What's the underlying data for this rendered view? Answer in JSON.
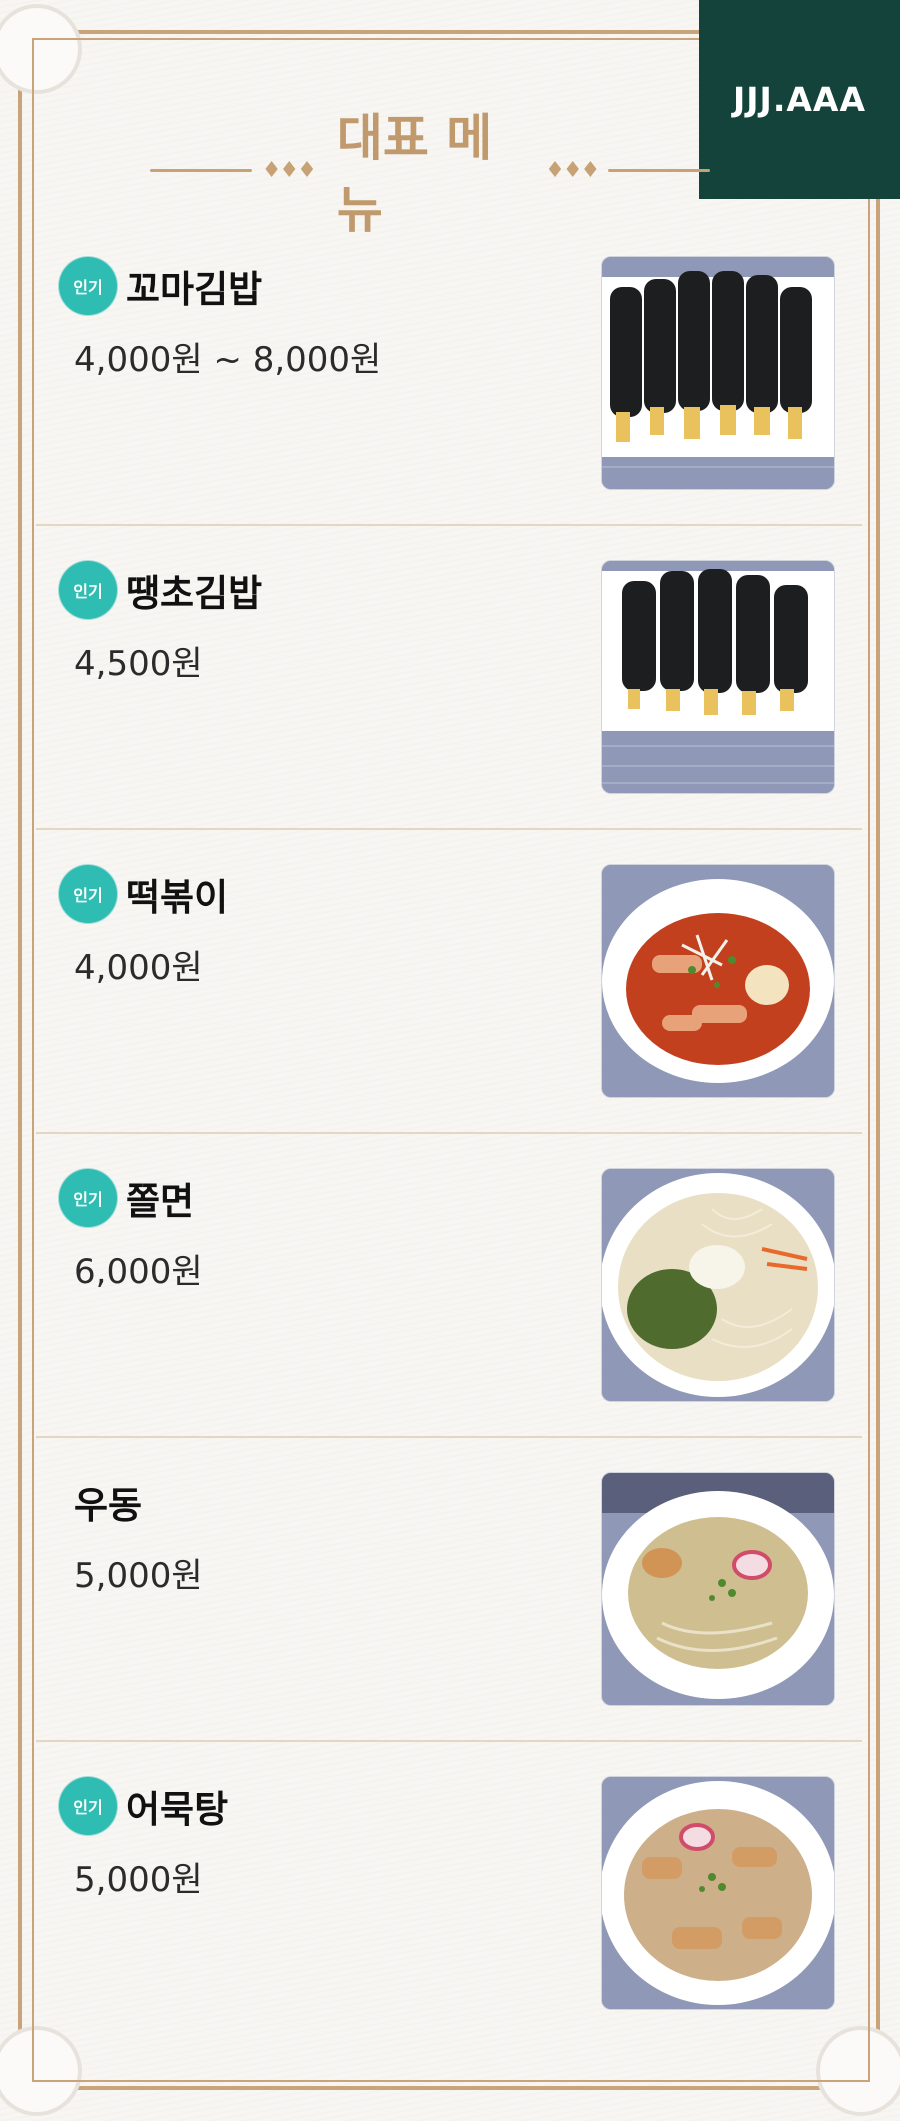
{
  "brand": {
    "logo_text": "JJJ.AAA",
    "logo_bg": "#13433a"
  },
  "header": {
    "title": "대표 메뉴",
    "ornament": "♦♦♦"
  },
  "colors": {
    "accent": "#c09a6c",
    "badge": "#2fbcb2"
  },
  "menu": [
    {
      "badge": "인기",
      "name": "꼬마김밥",
      "price": "4,000원 ~ 8,000원",
      "photo_icon": "mini-kimbap-photo"
    },
    {
      "badge": "인기",
      "name": "땡초김밥",
      "price": "4,500원",
      "photo_icon": "spicy-kimbap-photo"
    },
    {
      "badge": "인기",
      "name": "떡볶이",
      "price": "4,000원",
      "photo_icon": "tteokbokki-photo"
    },
    {
      "badge": "인기",
      "name": "쫄면",
      "price": "6,000원",
      "photo_icon": "jjolmyeon-photo"
    },
    {
      "badge": "",
      "name": "우동",
      "price": "5,000원",
      "photo_icon": "udon-photo"
    },
    {
      "badge": "인기",
      "name": "어묵탕",
      "price": "5,000원",
      "photo_icon": "fishcake-soup-photo"
    }
  ]
}
